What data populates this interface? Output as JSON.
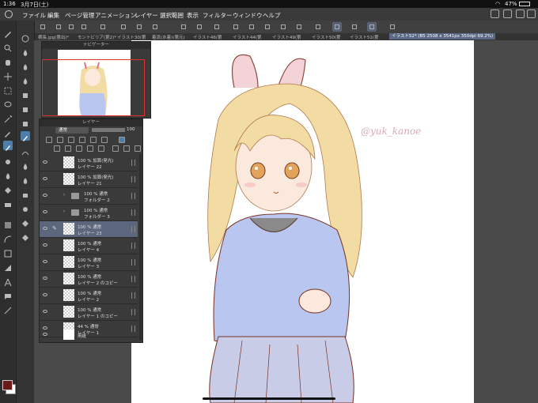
{
  "statusbar": {
    "time": "1:36",
    "date": "3月7日(土)",
    "battery": "47%"
  },
  "menu": {
    "items": [
      "ファイル",
      "編集",
      "ページ管理",
      "アニメーション",
      "レイヤー",
      "選択範囲",
      "表示",
      "フィルター",
      "ウィンドウ",
      "ヘルプ"
    ]
  },
  "tabs": [
    "横長.jpg(第出)*",
    "モントビリア(第2)*",
    "イラスト30(第",
    "着流(水着)(第元)",
    "イラスト46(第",
    "イラスト44(第",
    "イラスト49(第",
    "イラスト50(第",
    "イラスト51(第",
    "イラスト52* (B5 2508 x 3541px 350dpi 69.2%)"
  ],
  "navigator": {
    "title": "ナビゲーター"
  },
  "layer_panel": {
    "title": "レイヤー",
    "blend_mode": "通常",
    "opacity": "100",
    "layers": [
      {
        "line1": "100 % 加算(発光)",
        "line2": "レイヤー 22",
        "type": "layer",
        "selected": false
      },
      {
        "line1": "100 % 加算(発光)",
        "line2": "レイヤー 21",
        "type": "layer",
        "selected": false
      },
      {
        "line1": "100 % 通常",
        "line2": "フォルダー 2",
        "type": "folder",
        "selected": false
      },
      {
        "line1": "100 % 通常",
        "line2": "フォルダー 3",
        "type": "folder",
        "selected": false
      },
      {
        "line1": "100 % 通常",
        "line2": "レイヤー 23",
        "type": "layer",
        "selected": true
      },
      {
        "line1": "100 % 通常",
        "line2": "レイヤー 4",
        "type": "layer",
        "selected": false
      },
      {
        "line1": "100 % 通常",
        "line2": "レイヤー 3",
        "type": "layer",
        "selected": false
      },
      {
        "line1": "100 % 通常",
        "line2": "レイヤー 2 のコピー",
        "type": "layer",
        "selected": false
      },
      {
        "line1": "100 % 通常",
        "line2": "レイヤー 2",
        "type": "layer",
        "selected": false
      },
      {
        "line1": "100 % 通常",
        "line2": "レイヤー 1 のコピー",
        "type": "layer",
        "selected": false
      },
      {
        "line1": "44 % 通常",
        "line2": "レイヤー 1",
        "type": "layer",
        "selected": false
      },
      {
        "line1": "",
        "line2": "用紙",
        "type": "paper",
        "selected": false
      }
    ]
  },
  "canvas": {
    "watermark": "@yuk_kanoe"
  },
  "colors": {
    "main_color": "#6a1a1a",
    "sub_color": "#ffffff",
    "accent": "#5a6785"
  }
}
